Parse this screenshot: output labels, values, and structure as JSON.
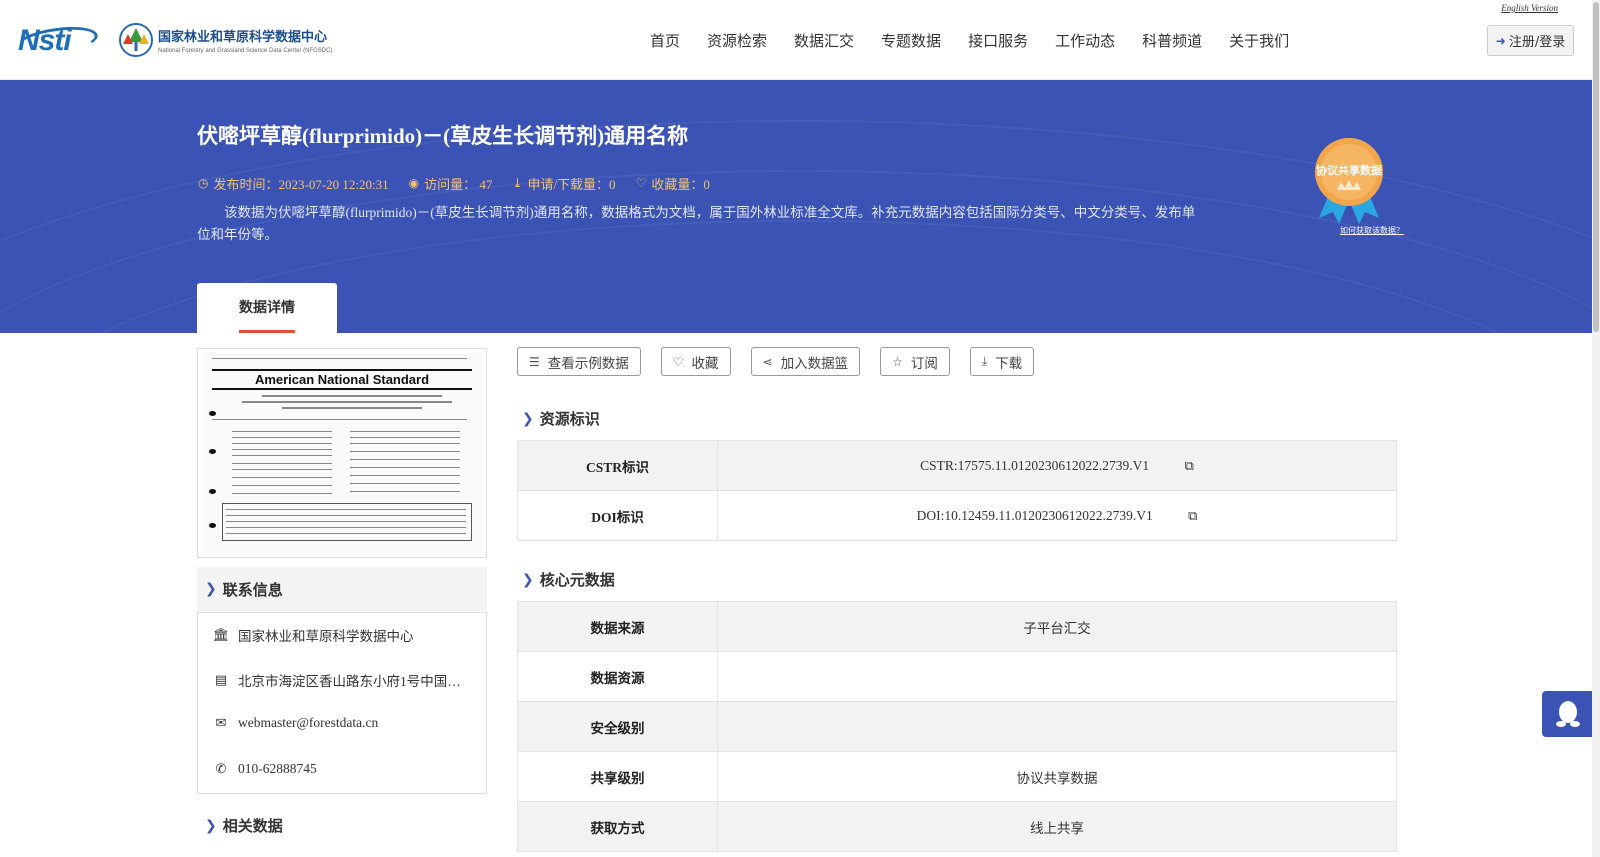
{
  "header": {
    "logo_left": "Nsti",
    "logo_cn": "国家林业和草原科学数据中心",
    "logo_en": "National Forestry and Grassland Science Data Center (NFGSDC)",
    "nav": [
      "首页",
      "资源检索",
      "数据汇交",
      "专题数据",
      "接口服务",
      "工作动态",
      "科普频道",
      "关于我们"
    ],
    "english_link": "English Version",
    "login_label": "注册/登录"
  },
  "hero": {
    "title": "伏嘧坪草醇(flurprimido)－(草皮生长调节剂)通用名称",
    "publish_time": "发布时间：2023-07-20 12:20:31",
    "visits": "访问量： 47",
    "downloads": "申请/下载量：0",
    "favorites": "收藏量：0",
    "description": "该数据为伏嘧坪草醇(flurprimido)－(草皮生长调节剂)通用名称，数据格式为文档，属于国外林业标准全文库。补充元数据内容包括国际分类号、中文分类号、发布单位和年份等。",
    "badge_label": "协议共享数据",
    "howto_link": "如何获取该数据？",
    "tab_label": "数据详情"
  },
  "preview": {
    "doc_title": "American National Standard"
  },
  "contact": {
    "heading": "联系信息",
    "org": "国家林业和草原科学数据中心",
    "address": "北京市海淀区香山路东小府1号中国…",
    "email": "webmaster@forestdata.cn",
    "phone": "010-62888745"
  },
  "related": {
    "heading": "相关数据"
  },
  "actions": {
    "sample": "查看示例数据",
    "favorite": "收藏",
    "basket": "加入数据篮",
    "subscribe": "订阅",
    "download": "下载"
  },
  "resource_id": {
    "heading": "资源标识",
    "rows": [
      {
        "key": "CSTR标识",
        "value": "CSTR:17575.11.0120230612022.2739.V1"
      },
      {
        "key": "DOI标识",
        "value": "DOI:10.12459.11.0120230612022.2739.V1"
      }
    ]
  },
  "core_meta": {
    "heading": "核心元数据",
    "rows": [
      {
        "key": "数据来源",
        "value": "子平台汇交"
      },
      {
        "key": "数据资源",
        "value": ""
      },
      {
        "key": "安全级别",
        "value": ""
      },
      {
        "key": "共享级别",
        "value": "协议共享数据"
      },
      {
        "key": "获取方式",
        "value": "线上共享"
      }
    ]
  },
  "colors": {
    "hero_bg": "#3b53b4",
    "meta_accent": "#f5c26b",
    "tab_underline": "#e84a3a"
  }
}
